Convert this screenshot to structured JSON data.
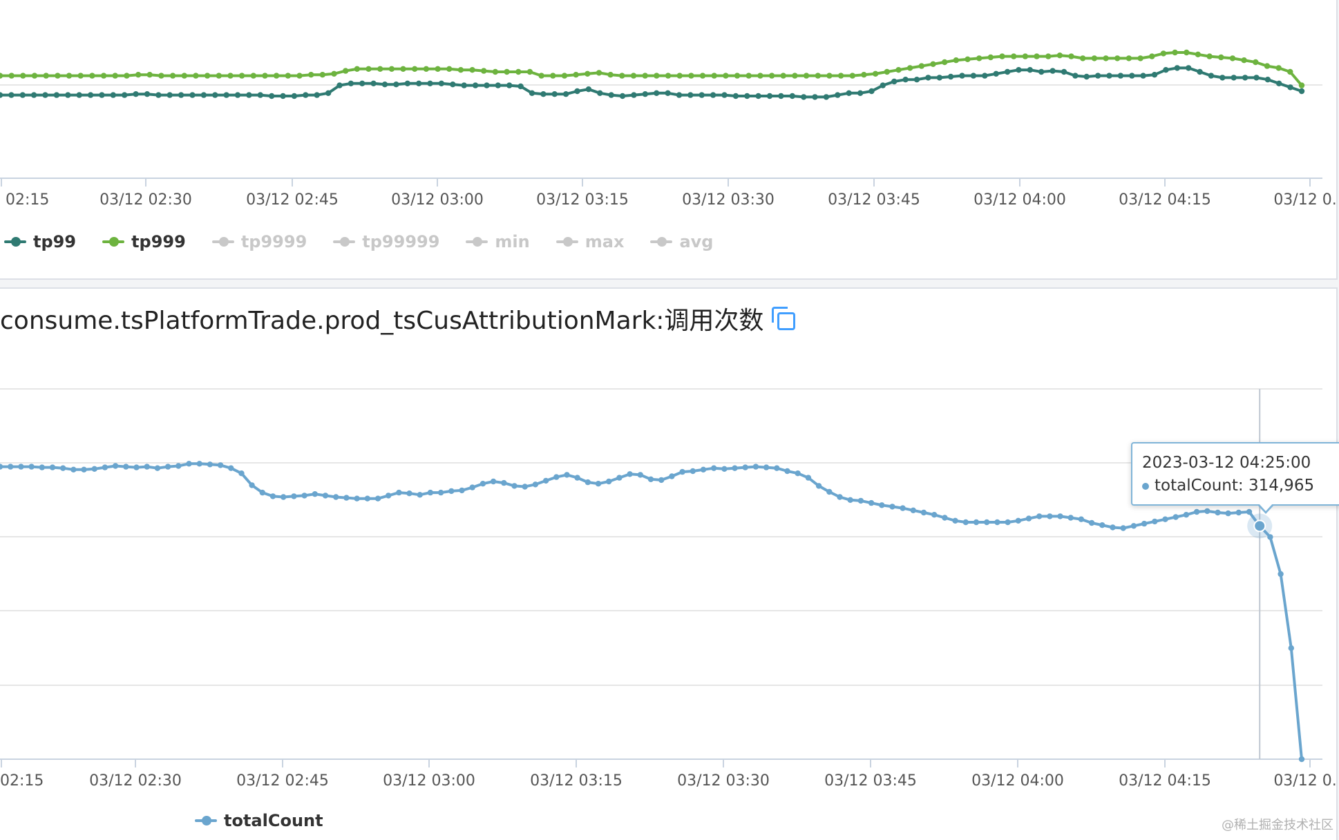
{
  "top_panel": {
    "legend": [
      {
        "name": "tp99",
        "color": "#2f7a72",
        "active": true
      },
      {
        "name": "tp999",
        "color": "#6db33f",
        "active": true
      },
      {
        "name": "tp9999",
        "color": "#c8c8c8",
        "active": false
      },
      {
        "name": "tp99999",
        "color": "#c8c8c8",
        "active": false
      },
      {
        "name": "min",
        "color": "#c8c8c8",
        "active": false
      },
      {
        "name": "max",
        "color": "#c8c8c8",
        "active": false
      },
      {
        "name": "avg",
        "color": "#c8c8c8",
        "active": false
      }
    ]
  },
  "bottom_panel": {
    "title": "consume.tsPlatformTrade.prod_tsCusAttributionMark:调用次数",
    "legend": [
      {
        "name": "totalCount",
        "color": "#6aa5ce",
        "active": true
      }
    ],
    "tooltip": {
      "time": "2023-03-12 04:25:00",
      "series": "totalCount",
      "value": "314,965"
    }
  },
  "watermark": "@稀土掘金技术社区",
  "chart_data": [
    {
      "type": "line",
      "x_ticks": [
        "02:15",
        "03/12 02:30",
        "03/12 02:45",
        "03/12 03:00",
        "03/12 03:15",
        "03/12 03:30",
        "03/12 03:45",
        "03/12 04:00",
        "03/12 04:15",
        "03/12 0..."
      ],
      "grid": true,
      "legend_position": "bottom-left",
      "series": [
        {
          "name": "tp99",
          "color": "#2f7a72",
          "values": [
            43,
            43,
            43,
            43,
            43,
            43,
            43,
            43,
            43,
            43,
            43,
            43,
            43.5,
            43.5,
            43,
            43,
            43,
            43,
            43,
            43,
            43,
            43,
            43,
            43,
            42.5,
            42.5,
            42.5,
            43,
            43,
            44,
            48,
            49,
            49,
            49,
            48.5,
            48.5,
            49,
            49,
            49,
            49,
            48.5,
            48,
            48,
            48,
            48,
            48,
            47.5,
            44,
            43.5,
            43.5,
            43.5,
            45,
            46,
            44,
            43,
            42.5,
            43,
            43.5,
            44,
            44,
            43,
            43,
            43,
            43,
            43,
            42.5,
            42.5,
            42.5,
            42.5,
            42.5,
            42.5,
            42,
            42,
            42,
            43,
            44,
            44,
            45,
            48,
            50,
            51,
            51,
            52,
            52,
            52.5,
            53,
            53,
            53,
            54,
            55,
            56,
            56,
            55,
            55.5,
            55,
            53,
            52.5,
            53,
            53,
            53,
            53,
            53,
            53.5,
            56,
            57,
            57,
            55,
            53,
            52,
            52,
            52,
            52,
            51,
            49,
            47,
            45
          ]
        },
        {
          "name": "tp999",
          "color": "#6db33f",
          "values": [
            53,
            53,
            53,
            53,
            53,
            53,
            53,
            53,
            53,
            53,
            53,
            53,
            53.5,
            53.5,
            53,
            53,
            53,
            53,
            53,
            53,
            53,
            53,
            53,
            53,
            53,
            53,
            53,
            53.5,
            53.5,
            54,
            55.5,
            56.5,
            56.5,
            56.5,
            56.5,
            56.5,
            56.5,
            56.5,
            56.5,
            56.5,
            56,
            56,
            55.5,
            55,
            55,
            55,
            55,
            53,
            53,
            53,
            53.5,
            54,
            54.5,
            53.5,
            53,
            53,
            53,
            53,
            53,
            53,
            53,
            53,
            53,
            53,
            53,
            53,
            53,
            53,
            53,
            53,
            53,
            53,
            53,
            53,
            53,
            53.5,
            54,
            55,
            56,
            57,
            58,
            59,
            60,
            61,
            61.5,
            62,
            62.5,
            63,
            63,
            63,
            63,
            63,
            63.5,
            63,
            62,
            62,
            62,
            62,
            62,
            62,
            63,
            64.5,
            65,
            65,
            64,
            63,
            62.5,
            62,
            61,
            60,
            58,
            57,
            55,
            48
          ]
        }
      ]
    },
    {
      "type": "line",
      "x_ticks": [
        "02:15",
        "03/12 02:30",
        "03/12 02:45",
        "03/12 03:00",
        "03/12 03:15",
        "03/12 03:30",
        "03/12 03:45",
        "03/12 04:00",
        "03/12 04:15",
        "03/12 0..."
      ],
      "grid": true,
      "legend_position": "bottom-left",
      "series": [
        {
          "name": "totalCount",
          "color": "#6aa5ce",
          "values": [
            395000,
            395000,
            395000,
            395000,
            394000,
            394000,
            393000,
            391000,
            391000,
            392000,
            394000,
            396000,
            395000,
            394000,
            395000,
            393000,
            395000,
            396000,
            399000,
            399000,
            398000,
            397000,
            393000,
            386000,
            370000,
            360000,
            355000,
            354000,
            355000,
            356000,
            358000,
            356000,
            354000,
            353000,
            352000,
            352000,
            352000,
            356000,
            360000,
            359000,
            357000,
            360000,
            360000,
            362000,
            363000,
            367000,
            372000,
            375000,
            373000,
            369000,
            368000,
            371000,
            376000,
            381000,
            384000,
            380000,
            374000,
            372000,
            375000,
            380000,
            385000,
            384000,
            378000,
            377000,
            382000,
            388000,
            389000,
            391000,
            393000,
            392000,
            393000,
            394000,
            395000,
            394000,
            393000,
            389000,
            386000,
            380000,
            369000,
            361000,
            354000,
            350000,
            349000,
            346000,
            343000,
            341000,
            339000,
            336000,
            333000,
            330000,
            326000,
            322000,
            320000,
            320000,
            320000,
            320000,
            320000,
            322000,
            325000,
            328000,
            328000,
            328000,
            326000,
            324000,
            319000,
            316000,
            313000,
            312000,
            315000,
            318000,
            321000,
            324000,
            327000,
            330000,
            334000,
            335000,
            333000,
            332000,
            333000,
            334000,
            314965,
            300000,
            250000,
            150000,
            0
          ]
        }
      ]
    }
  ]
}
